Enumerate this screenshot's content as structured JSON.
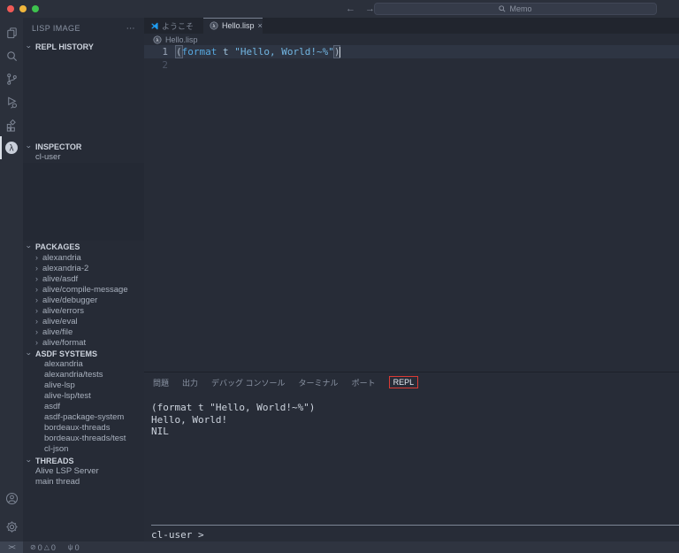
{
  "titlebar": {
    "search_label": "Memo"
  },
  "icons": {
    "back": "←",
    "forward": "→",
    "more": "⋯",
    "close": "×",
    "chevron_down": "›",
    "chevron_right": "›",
    "error": "⊘",
    "warning": "△",
    "ports": "ψ",
    "remote": "><",
    "lambda": "λ"
  },
  "editor_tabs": {
    "welcome": "ようこそ",
    "file": "Hello.lisp"
  },
  "breadcrumb": {
    "file": "Hello.lisp"
  },
  "sidebar": {
    "title": "LISP IMAGE",
    "sections": {
      "repl_history": "REPL HISTORY",
      "inspector": "INSPECTOR",
      "packages": "PACKAGES",
      "asdf": "ASDF SYSTEMS",
      "threads": "THREADS"
    },
    "inspector_items": [
      "cl-user"
    ],
    "packages": [
      "alexandria",
      "alexandria-2",
      "alive/asdf",
      "alive/compile-message",
      "alive/debugger",
      "alive/errors",
      "alive/eval",
      "alive/file",
      "alive/format"
    ],
    "asdf_systems": [
      "alexandria",
      "alexandria/tests",
      "alive-lsp",
      "alive-lsp/test",
      "asdf",
      "asdf-package-system",
      "bordeaux-threads",
      "bordeaux-threads/test",
      "cl-json"
    ],
    "threads": [
      "Alive LSP Server",
      "main thread"
    ]
  },
  "editor": {
    "line_numbers": [
      "1",
      "2"
    ],
    "code": {
      "open": "(",
      "keyword": "format",
      "space1": " ",
      "arg": "t",
      "space2": " ",
      "string": "\"Hello, World!~%\"",
      "close": ")"
    }
  },
  "panel": {
    "tabs": [
      "問題",
      "出力",
      "デバッグ コンソール",
      "ターミナル",
      "ポート",
      "REPL"
    ],
    "repl_output": [
      "(format t \"Hello, World!~%\")",
      "Hello, World!",
      "NIL"
    ],
    "prompt": "cl-user >"
  },
  "statusbar": {
    "errors": "0",
    "warnings": "0",
    "ports": "0"
  },
  "colors": {
    "annotation_red": "#da3b35",
    "keyword_blue": "#57a9e0",
    "string_blue": "#72b6e2"
  }
}
